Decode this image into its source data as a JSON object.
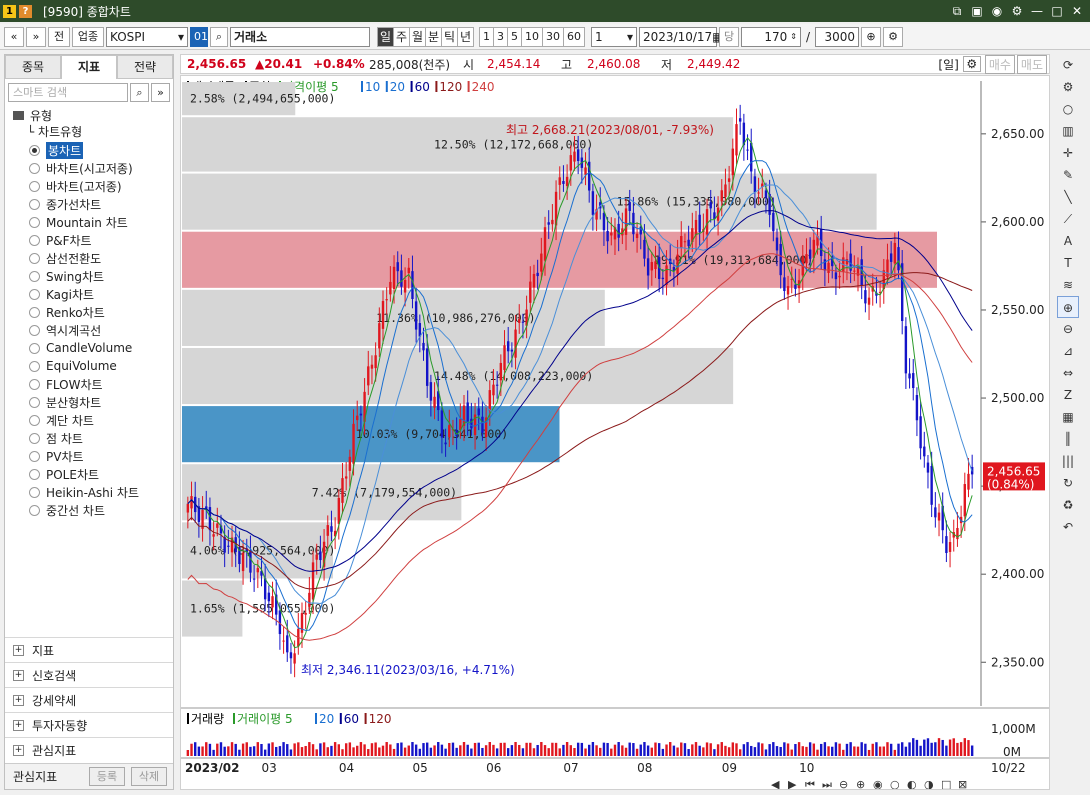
{
  "window": {
    "title": "[9590] 종합차트",
    "icons": [
      "1",
      "?"
    ]
  },
  "toolbar": {
    "nav_prev": "«",
    "nav_next": "»",
    "jeon": "전",
    "market_type": "업종",
    "index_name": "KOSPI",
    "code_btn": "01",
    "search_icon": "search-icon",
    "exchange": "거래소",
    "periods": [
      "일",
      "주",
      "월",
      "분",
      "틱",
      "년"
    ],
    "active_period": "일",
    "numbers": [
      "1",
      "3",
      "5",
      "10",
      "30",
      "60"
    ],
    "unit_value": "1",
    "date": "2023/10/17",
    "dang": "당",
    "count": "170",
    "slash": "/",
    "max_count": "3000"
  },
  "left_panel": {
    "tabs": [
      "종목",
      "지표",
      "전략"
    ],
    "active_tab": "지표",
    "search_placeholder": "스마트 검색",
    "section_title": "유형",
    "subsection_title": "차트유형",
    "chart_types": [
      "봉차트",
      "바차트(시고저종)",
      "바차트(고저종)",
      "종가선차트",
      "Mountain 차트",
      "P&F차트",
      "삼선전환도",
      "Swing차트",
      "Kagi차트",
      "Renko차트",
      "역시계곡선",
      "CandleVolume",
      "EquiVolume",
      "FLOW차트",
      "분산형차트",
      "계단 차트",
      "점 차트",
      "PV차트",
      "POLE차트",
      "Heikin-Ashi 차트",
      "중간선 차트"
    ],
    "selected_type": "봉차트",
    "bottom_sections": [
      "지표",
      "신호검색",
      "강세약세",
      "투자자동향",
      "관심지표"
    ],
    "footer": {
      "label": "관심지표",
      "register": "등록",
      "delete": "삭제"
    }
  },
  "quote": {
    "price": "2,456.65",
    "change": "▲20.41",
    "change_pct": "+0.84%",
    "volume": "285,008(천주)",
    "open_label": "시",
    "open": "2,454.14",
    "high_label": "고",
    "high": "2,460.08",
    "low_label": "저",
    "low": "2,449.42",
    "period_badge": "[일]",
    "buy": "매수",
    "sell": "매도"
  },
  "chart_data": {
    "type": "candlestick",
    "legend": [
      {
        "text": "대기매물",
        "color": "#000000"
      },
      {
        "text": "종합",
        "color": "#000000"
      },
      {
        "text": "가격이평 5",
        "color": "#2a9a2a"
      },
      {
        "text": "10",
        "color": "#1a6fd0"
      },
      {
        "text": "20",
        "color": "#1a6fd0"
      },
      {
        "text": "60",
        "color": "#00008b"
      },
      {
        "text": "120",
        "color": "#8b1a1a"
      },
      {
        "text": "240",
        "color": "#d04040"
      }
    ],
    "y_ticks": [
      "2,650.00",
      "2,600.00",
      "2,550.00",
      "2,500.00",
      "2,450.00",
      "2,400.00",
      "2,350.00"
    ],
    "ylim": [
      2328,
      2680
    ],
    "current_price_label": "2,456.65",
    "current_pct_label": "(0.84%)",
    "high_annotation": "최고 2,668.21(2023/08/01, -7.93%)",
    "low_annotation": "최저 2,346.11(2023/03/16, +4.71%)",
    "volume_profile": [
      {
        "lo": 2595,
        "hi": 2628,
        "pct": "15.86%",
        "vol": "15,335,080,000",
        "color": "#d6d6d6",
        "frac": 0.92
      },
      {
        "lo": 2628,
        "hi": 2660,
        "pct": "12.50%",
        "vol": "12,172,668,000",
        "color": "#d6d6d6",
        "frac": 0.73
      },
      {
        "lo": 2660,
        "hi": 2680,
        "pct": "2.58%",
        "vol": "2,494,655,000",
        "color": "#d6d6d6",
        "frac": 0.15
      },
      {
        "lo": 2562,
        "hi": 2595,
        "pct": "19.91%",
        "vol": "19,313,684,000",
        "color": "#e69aa2",
        "frac": 1.0
      },
      {
        "lo": 2529,
        "hi": 2562,
        "pct": "11.36%",
        "vol": "10,986,276,000",
        "color": "#d6d6d6",
        "frac": 0.56
      },
      {
        "lo": 2496,
        "hi": 2529,
        "pct": "14.48%",
        "vol": "14,008,223,000",
        "color": "#d6d6d6",
        "frac": 0.73
      },
      {
        "lo": 2463,
        "hi": 2496,
        "pct": "10.03%",
        "vol": "9,704,341,000",
        "color": "#4a95c7",
        "frac": 0.5
      },
      {
        "lo": 2430,
        "hi": 2463,
        "pct": "7.42%",
        "vol": "7,179,554,000",
        "color": "#d6d6d6",
        "frac": 0.37
      },
      {
        "lo": 2397,
        "hi": 2430,
        "pct": "4.06%",
        "vol": "3,925,564,000",
        "color": "#d6d6d6",
        "frac": 0.2
      },
      {
        "lo": 2364,
        "hi": 2397,
        "pct": "1.65%",
        "vol": "1,595,055,000",
        "color": "#d6d6d6",
        "frac": 0.08
      }
    ],
    "x_labels": [
      "2023/02",
      "03",
      "04",
      "05",
      "06",
      "07",
      "08",
      "09",
      "10"
    ],
    "x_end_label": "10/22",
    "close_anchors": [
      [
        0,
        2440
      ],
      [
        5,
        2432
      ],
      [
        10,
        2418
      ],
      [
        15,
        2410
      ],
      [
        20,
        2396
      ],
      [
        25,
        2372
      ],
      [
        27,
        2350
      ],
      [
        30,
        2365
      ],
      [
        35,
        2410
      ],
      [
        40,
        2430
      ],
      [
        45,
        2480
      ],
      [
        50,
        2520
      ],
      [
        55,
        2570
      ],
      [
        60,
        2568
      ],
      [
        65,
        2510
      ],
      [
        70,
        2476
      ],
      [
        75,
        2490
      ],
      [
        80,
        2485
      ],
      [
        85,
        2520
      ],
      [
        90,
        2540
      ],
      [
        95,
        2575
      ],
      [
        100,
        2615
      ],
      [
        103,
        2630
      ],
      [
        106,
        2640
      ],
      [
        110,
        2610
      ],
      [
        115,
        2590
      ],
      [
        120,
        2605
      ],
      [
        125,
        2575
      ],
      [
        130,
        2570
      ],
      [
        135,
        2590
      ],
      [
        140,
        2600
      ],
      [
        145,
        2612
      ],
      [
        148,
        2640
      ],
      [
        150,
        2660
      ],
      [
        153,
        2625
      ],
      [
        158,
        2610
      ],
      [
        160,
        2578
      ],
      [
        163,
        2560
      ],
      [
        166,
        2570
      ],
      [
        170,
        2590
      ],
      [
        175,
        2570
      ],
      [
        180,
        2578
      ],
      [
        185,
        2555
      ],
      [
        189,
        2568
      ],
      [
        192,
        2590
      ],
      [
        195,
        2520
      ],
      [
        198,
        2490
      ],
      [
        200,
        2463
      ],
      [
        203,
        2435
      ],
      [
        206,
        2418
      ],
      [
        208,
        2418
      ],
      [
        211,
        2448
      ],
      [
        213,
        2456.65
      ]
    ],
    "volume_chart": {
      "legend": [
        "거래량",
        "거래이평 5",
        "20",
        "60",
        "120"
      ],
      "y_ticks": [
        "1,000M",
        "0M"
      ]
    }
  },
  "right_tools": [
    "refresh-icon",
    "gear-icon",
    "circle-icon",
    "bar-chart-icon",
    "crosshair-icon",
    "pencil-icon",
    "line-icon",
    "diagonal-line-icon",
    "auto-icon",
    "text-icon",
    "fibonacci-icon",
    "zoom-icon",
    "zoom-out-icon",
    "measure-icon",
    "scale-icon",
    "z-icon",
    "grid-icon",
    "bars-icon",
    "period-icon",
    "rotate-icon",
    "recycle-icon",
    "undo-icon"
  ]
}
